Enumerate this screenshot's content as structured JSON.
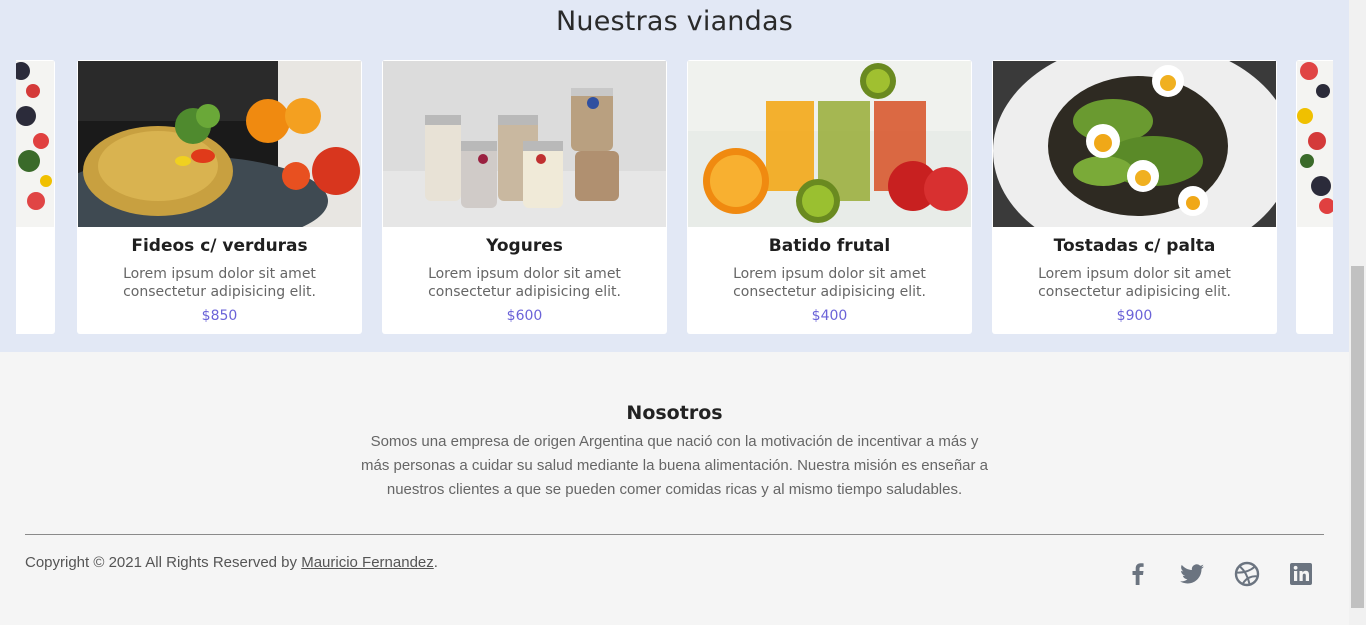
{
  "viandas": {
    "title": "Nuestras viandas",
    "cards": [
      {
        "title": "Fideos c/ verduras",
        "desc": "Lorem ipsum dolor sit amet consectetur adipisicing elit.",
        "price": "$850"
      },
      {
        "title": "Yogures",
        "desc": "Lorem ipsum dolor sit amet consectetur adipisicing elit.",
        "price": "$600"
      },
      {
        "title": "Batido frutal",
        "desc": "Lorem ipsum dolor sit amet consectetur adipisicing elit.",
        "price": "$400"
      },
      {
        "title": "Tostadas c/ palta",
        "desc": "Lorem ipsum dolor sit amet consectetur adipisicing elit.",
        "price": "$900"
      }
    ]
  },
  "nosotros": {
    "title": "Nosotros",
    "text": "Somos una empresa de origen Argentina que nació con la motivación de incentivar a más y más personas a cuidar su salud mediante la buena alimentación. Nuestra misión es enseñar a nuestros clientes a que se pueden comer comidas ricas y al mismo tiempo saludables."
  },
  "footer": {
    "copyright_prefix": "Copyright © 2021 All Rights Reserved by ",
    "author": "Mauricio Fernandez",
    "copyright_suffix": ".",
    "social_icons": [
      "facebook-icon",
      "twitter-icon",
      "dribbble-icon",
      "linkedin-icon"
    ]
  },
  "colors": {
    "section_bg": "#e2e8f5",
    "price": "#6b63d8",
    "footer_bg": "#f5f5f5"
  }
}
